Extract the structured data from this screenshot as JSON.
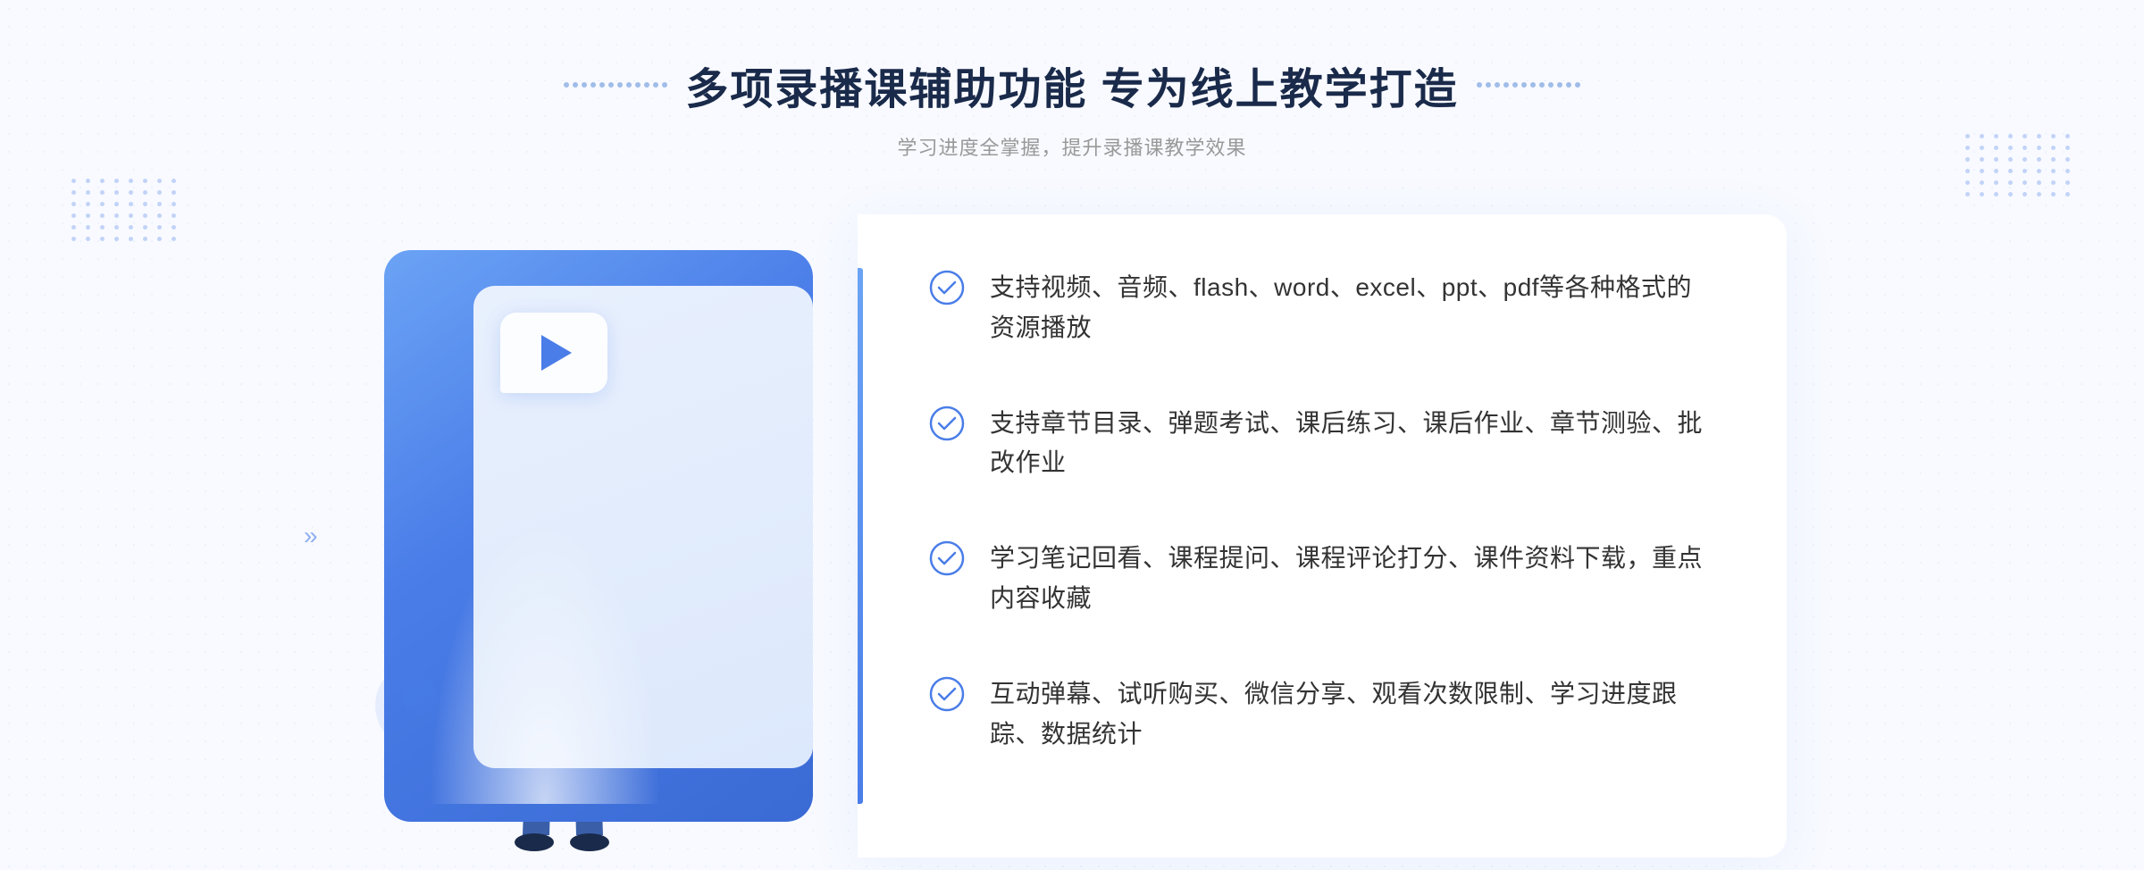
{
  "header": {
    "title": "多项录播课辅助功能 专为线上教学打造",
    "subtitle": "学习进度全掌握，提升录播课教学效果",
    "title_dots_left": "decorative",
    "title_dots_right": "decorative"
  },
  "features": [
    {
      "id": 1,
      "text": "支持视频、音频、flash、word、excel、ppt、pdf等各种格式的资源播放"
    },
    {
      "id": 2,
      "text": "支持章节目录、弹题考试、课后练习、课后作业、章节测验、批改作业"
    },
    {
      "id": 3,
      "text": "学习笔记回看、课程提问、课程评论打分、课件资料下载，重点内容收藏"
    },
    {
      "id": 4,
      "text": "互动弹幕、试听购买、微信分享、观看次数限制、学习进度跟踪、数据统计"
    }
  ],
  "colors": {
    "primary": "#4a7de8",
    "primary_light": "#6ba3f5",
    "text_dark": "#1a2a4a",
    "text_normal": "#333333",
    "text_light": "#999999",
    "bg_light": "#f8faff",
    "accent_check": "#4a7de8"
  },
  "left_arrows": "»",
  "illustration": {
    "play_button": "▶"
  }
}
